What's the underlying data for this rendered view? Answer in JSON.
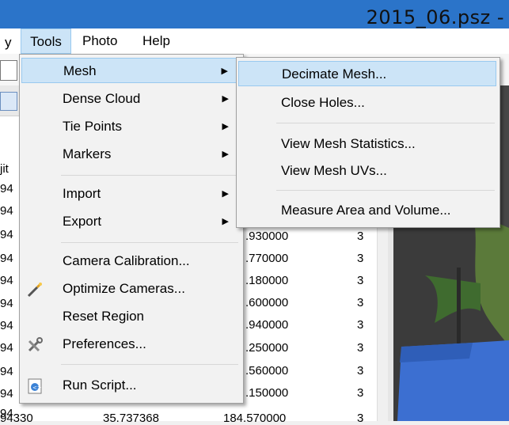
{
  "window": {
    "title": "2015_06.psz -",
    "accent": "#2b74c9"
  },
  "menubar": {
    "items": [
      {
        "label": "Tools"
      },
      {
        "label": "Photo"
      },
      {
        "label": "Help"
      }
    ],
    "left_fragment": "y"
  },
  "table": {
    "side_labels": [
      "jit",
      "94",
      "94",
      "94",
      "94",
      "94",
      "94",
      "94",
      "94",
      "94",
      "94",
      "94"
    ],
    "rows": [
      {
        "z": ".930000",
        "n": "3"
      },
      {
        "z": ".770000",
        "n": "3"
      },
      {
        "z": ".180000",
        "n": "3"
      },
      {
        "z": ".600000",
        "n": "3"
      },
      {
        "z": ".940000",
        "n": "3"
      },
      {
        "z": ".250000",
        "n": "3"
      },
      {
        "z": ".560000",
        "n": "3"
      },
      {
        "z": ".150000",
        "n": "3"
      }
    ],
    "last_row": {
      "a": "94330",
      "b": "35.737368",
      "c": "184.570000",
      "n": "3"
    }
  },
  "tools_menu": {
    "items": [
      {
        "label": "Mesh",
        "submenu": true
      },
      {
        "label": "Dense Cloud",
        "submenu": true
      },
      {
        "label": "Tie Points",
        "submenu": true
      },
      {
        "label": "Markers",
        "submenu": true
      },
      {
        "label": "Import",
        "submenu": true
      },
      {
        "label": "Export",
        "submenu": true
      },
      {
        "label": "Camera Calibration..."
      },
      {
        "label": "Optimize Cameras...",
        "icon": "wand-icon"
      },
      {
        "label": "Reset Region"
      },
      {
        "label": "Preferences...",
        "icon": "tools-icon"
      },
      {
        "label": "Run Script...",
        "icon": "script-icon"
      }
    ]
  },
  "mesh_submenu": {
    "items": [
      {
        "label": "Decimate Mesh..."
      },
      {
        "label": "Close Holes..."
      },
      {
        "label": "View Mesh Statistics..."
      },
      {
        "label": "View Mesh UVs..."
      },
      {
        "label": "Measure Area and Volume..."
      }
    ]
  }
}
